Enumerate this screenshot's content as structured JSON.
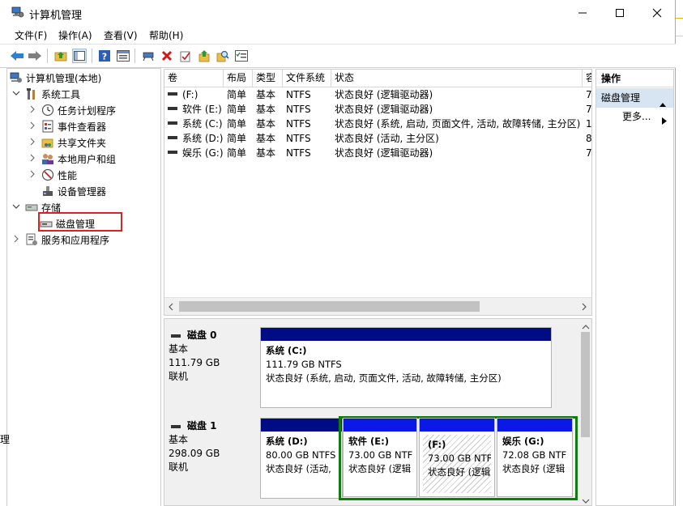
{
  "window": {
    "title": "计算机管理"
  },
  "title_controls": {
    "minimize": "—",
    "maximize": "☐",
    "close": "✕"
  },
  "menu": [
    "文件(F)",
    "操作(A)",
    "查看(V)",
    "帮助(H)"
  ],
  "toolbar": {
    "icons": [
      "back-arrow-icon",
      "forward-arrow-icon",
      "up-folder-icon",
      "show-hide-tree-icon",
      "help-icon",
      "properties-icon",
      "connect-icon",
      "delete-icon",
      "check-icon",
      "export-icon",
      "search-icon",
      "list-icon"
    ]
  },
  "tree": {
    "root": "计算机管理(本地)",
    "system_tools": "系统工具",
    "task_scheduler": "任务计划程序",
    "event_viewer": "事件查看器",
    "shared_folders": "共享文件夹",
    "local_users": "本地用户和组",
    "performance": "性能",
    "device_manager": "设备管理器",
    "storage": "存储",
    "disk_management": "磁盘管理",
    "services_apps": "服务和应用程序"
  },
  "volume_list": {
    "columns": [
      "卷",
      "布局",
      "类型",
      "文件系统",
      "状态",
      "容"
    ],
    "rows": [
      [
        "(F:)",
        "简单",
        "基本",
        "NTFS",
        "状态良好 (逻辑驱动器)",
        "7"
      ],
      [
        "软件 (E:)",
        "简单",
        "基本",
        "NTFS",
        "状态良好 (逻辑驱动器)",
        "7"
      ],
      [
        "系统 (C:)",
        "简单",
        "基本",
        "NTFS",
        "状态良好 (系统, 启动, 页面文件, 活动, 故障转储, 主分区)",
        "1"
      ],
      [
        "系统 (D:)",
        "简单",
        "基本",
        "NTFS",
        "状态良好 (活动, 主分区)",
        "8"
      ],
      [
        "娱乐 (G:)",
        "简单",
        "基本",
        "NTFS",
        "状态良好 (逻辑驱动器)",
        "7"
      ]
    ]
  },
  "disks": [
    {
      "name": "磁盘 0",
      "type": "基本",
      "size": "111.79 GB",
      "status": "联机",
      "partitions": [
        {
          "name": "系统  (C:)",
          "size": "111.79 GB NTFS",
          "status": "状态良好 (系统, 启动, 页面文件, 活动, 故障转储, 主分区)"
        }
      ]
    },
    {
      "name": "磁盘 1",
      "type": "基本",
      "size": "298.09 GB",
      "status": "联机",
      "partitions": [
        {
          "name": "系统  (D:)",
          "size": "80.00 GB NTFS",
          "status": "状态良好 (活动,"
        },
        {
          "name": "软件  (E:)",
          "size": "73.00 GB NTF",
          "status": "状态良好 (逻辑"
        },
        {
          "name": "(F:)",
          "size": "73.00 GB NTF",
          "status": "状态良好 (逻辑"
        },
        {
          "name": "娱乐  (G:)",
          "size": "72.08 GB NTF",
          "status": "状态良好 (逻辑"
        }
      ]
    }
  ],
  "actions": {
    "header": "操作",
    "section": "磁盘管理",
    "more": "更多..."
  },
  "left_edge_text": "理",
  "colors": {
    "primary_bar": "#000c84",
    "logical_bar": "#0a18e8",
    "selection_border": "#0e7d0e",
    "highlight_box": "#e02020"
  }
}
